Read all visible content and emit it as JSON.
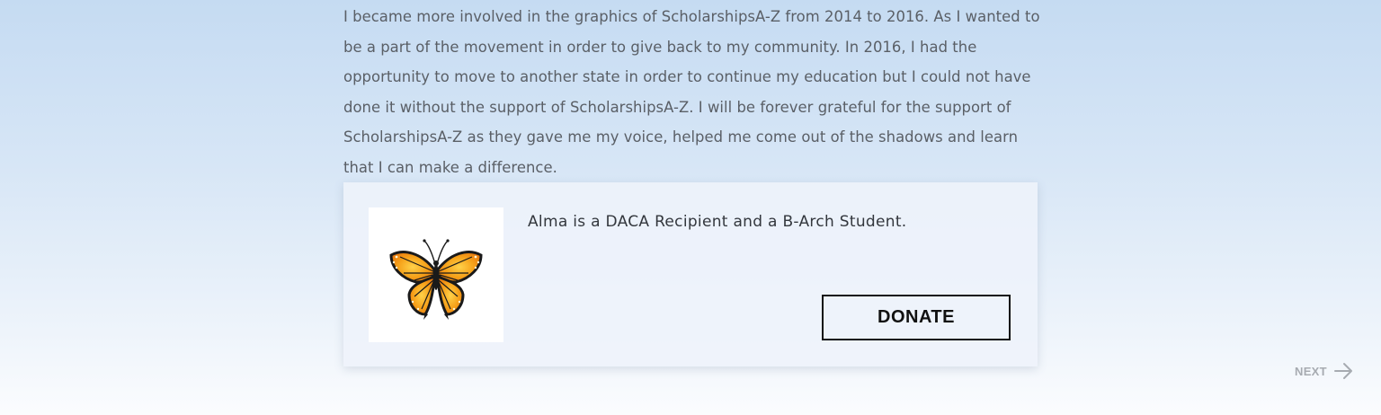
{
  "story": {
    "text": "I became more involved in the graphics of ScholarshipsA-Z from 2014 to 2016. As I wanted to be a part of the movement in order to give back to my community. In 2016, I had the opportunity to move to another state in order to continue my education but I could not have done it without the support of ScholarshipsA-Z. I will be forever grateful for the support of ScholarshipsA-Z as they gave me my voice, helped me come out of the shadows and learn that I can make a difference."
  },
  "profile": {
    "image_icon": "monarch-butterfly",
    "bio": "Alma is a DACA Recipient and a B-Arch Student.",
    "donate_label": "DONATE"
  },
  "navigation": {
    "next_label": "NEXT",
    "next_icon": "arrow-right-icon"
  },
  "colors": {
    "butterfly_orange": "#f39a12",
    "butterfly_black": "#1a1a1a"
  }
}
